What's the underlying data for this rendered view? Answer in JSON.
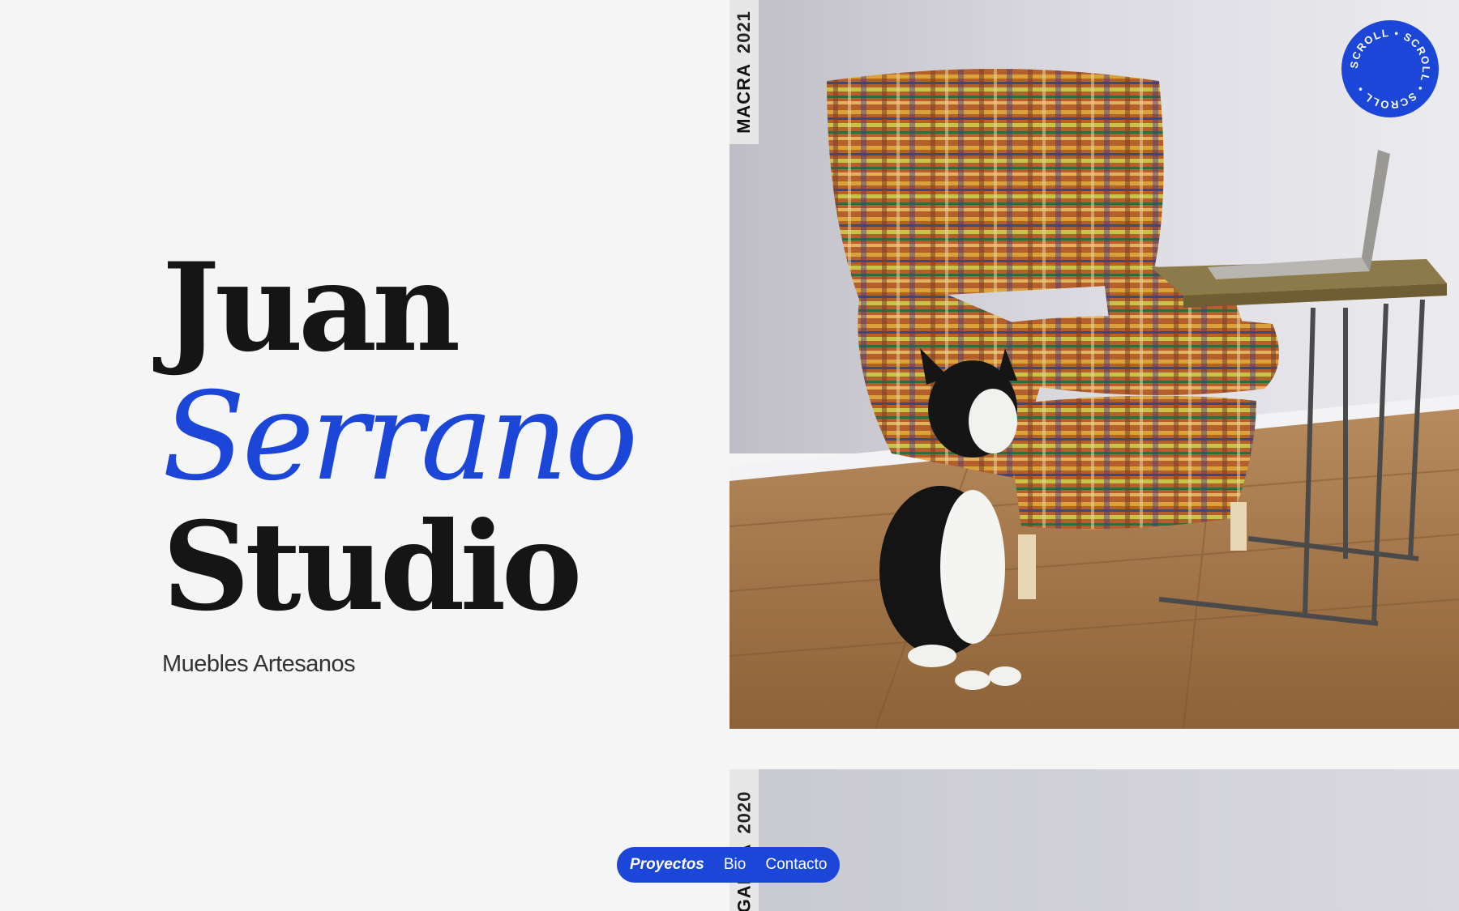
{
  "hero": {
    "line1": "Juan",
    "line2": "Serrano",
    "line3": "Studio",
    "subtitle": "Muebles Artesanos"
  },
  "projects": [
    {
      "name": "MACRA",
      "year": "2021"
    },
    {
      "name": "GARRA",
      "year": "2020"
    }
  ],
  "scroll_badge": {
    "text": "SCROLL • SCROLL • SCROLL • "
  },
  "nav": {
    "items": [
      {
        "label": "Proyectos",
        "active": true
      },
      {
        "label": "Bio",
        "active": false
      },
      {
        "label": "Contacto",
        "active": false
      }
    ]
  },
  "colors": {
    "accent": "#1c46d8",
    "background": "#f5f5f5",
    "text": "#151515"
  },
  "icons": [
    "scroll-badge-icon"
  ]
}
